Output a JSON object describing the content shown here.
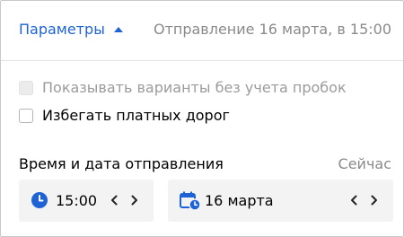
{
  "params": {
    "label": "Параметры",
    "expanded": true,
    "accent_color": "#1e63d6"
  },
  "departure_summary": "Отправление 16 марта, в 15:00",
  "options": [
    {
      "label": "Показывать варианты без учета пробок",
      "checked": false,
      "disabled": true
    },
    {
      "label": "Избегать платных дорог",
      "checked": false,
      "disabled": false
    }
  ],
  "departure": {
    "title": "Время и дата отправления",
    "now_label": "Сейчас",
    "time": {
      "value": "15:00",
      "icon": "clock-icon"
    },
    "date": {
      "value": "16 марта",
      "icon": "calendar-clock-icon"
    }
  }
}
